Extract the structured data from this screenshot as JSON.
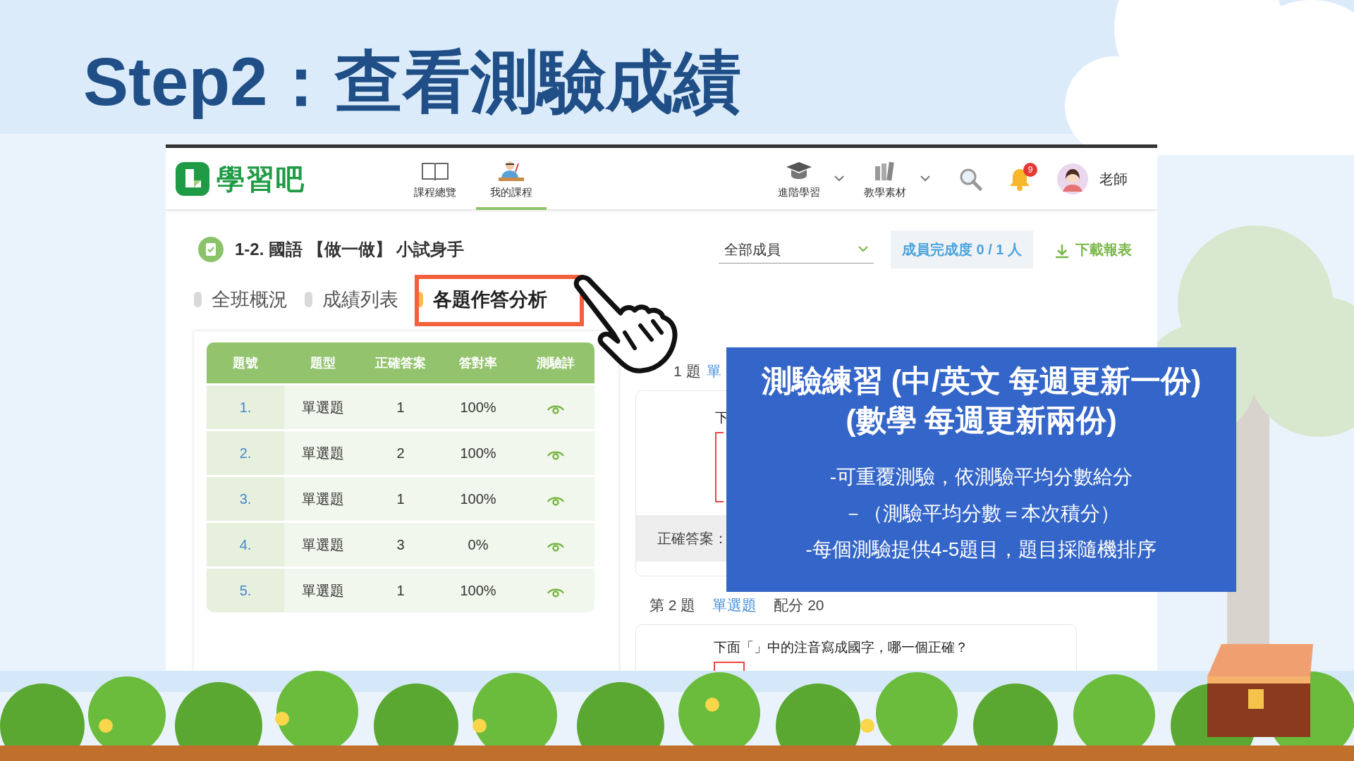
{
  "slide": {
    "title": "Step2：查看測驗成績"
  },
  "app": {
    "logo": "學習吧",
    "nav": [
      {
        "label": "課程總覽",
        "kind": "book",
        "selected": false,
        "dropdown": false
      },
      {
        "label": "我的課程",
        "kind": "teacher",
        "selected": true,
        "dropdown": false
      },
      {
        "label": "進階學習",
        "kind": "cap",
        "selected": false,
        "dropdown": true
      },
      {
        "label": "教學素材",
        "kind": "books",
        "selected": false,
        "dropdown": true
      }
    ],
    "notifications": "9",
    "user": "老師"
  },
  "page": {
    "title": "1-2. 國語 【做一做】 小試身手",
    "member_filter": "全部成員",
    "completion": "成員完成度 0 / 1 人",
    "download": "下載報表"
  },
  "tabs": [
    {
      "label": "全班概況",
      "selected": false
    },
    {
      "label": "成績列表",
      "selected": false
    },
    {
      "label": "各題作答分析",
      "selected": true
    }
  ],
  "table": {
    "columns": [
      "題號",
      "題型",
      "正確答案",
      "答對率",
      "測驗詳"
    ],
    "rows": [
      {
        "no": "1.",
        "type": "單選題",
        "answer": "1",
        "rate": "100%"
      },
      {
        "no": "2.",
        "type": "單選題",
        "answer": "2",
        "rate": "100%"
      },
      {
        "no": "3.",
        "type": "單選題",
        "answer": "1",
        "rate": "100%"
      },
      {
        "no": "4.",
        "type": "單選題",
        "answer": "3",
        "rate": "0%"
      },
      {
        "no": "5.",
        "type": "單選題",
        "answer": "1",
        "rate": "100%"
      }
    ]
  },
  "questions": [
    {
      "number": "1 題",
      "type": "單",
      "text": "下",
      "answer_label": "正確答案："
    },
    {
      "number": "第 2 題",
      "type": "單選題",
      "score": "配分 20",
      "text": "下面「」中的注音寫成國字，哪一個正確？"
    }
  ],
  "callout": {
    "title": [
      "測驗練習 (中/英文 每週更新一份)",
      "(數學 每週更新兩份)"
    ],
    "notes": [
      "-可重覆測驗，依測驗平均分數給分",
      "－（測驗平均分數＝本次積分）",
      "-每個測驗提供4-5題目，題目採隨機排序"
    ]
  }
}
